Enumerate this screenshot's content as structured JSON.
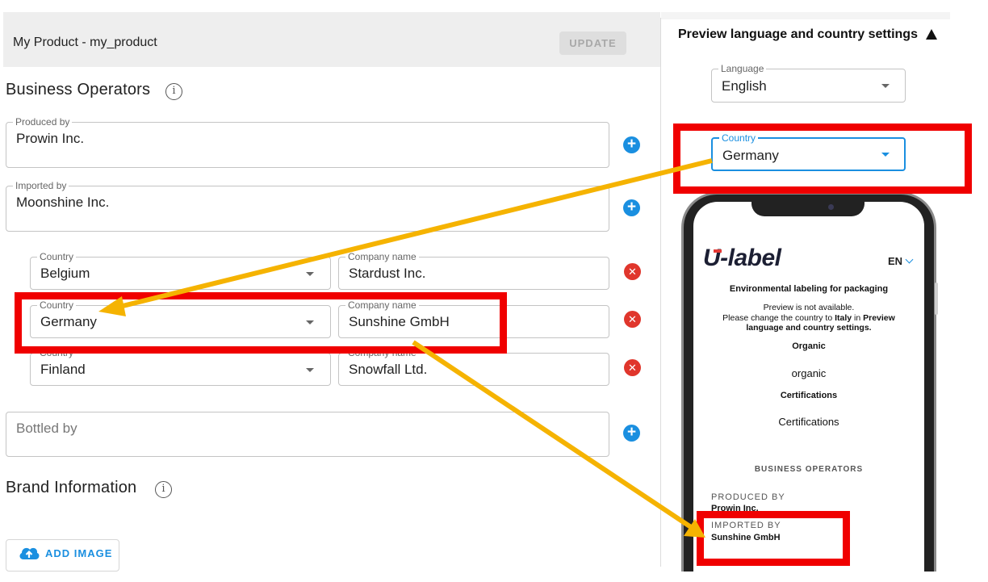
{
  "header": {
    "title": "My Product - my_product",
    "update_label": "UPDATE"
  },
  "business_operators": {
    "heading": "Business Operators",
    "produced_by": {
      "label": "Produced by",
      "value": "Prowin Inc."
    },
    "imported_by": {
      "label": "Imported by",
      "value": "Moonshine Inc."
    },
    "rows": [
      {
        "country_label": "Country",
        "country": "Belgium",
        "company_label": "Company name",
        "company": "Stardust Inc."
      },
      {
        "country_label": "Country",
        "country": "Germany",
        "company_label": "Company name",
        "company": "Sunshine GmbH"
      },
      {
        "country_label": "Country",
        "country": "Finland",
        "company_label": "Company name",
        "company": "Snowfall Ltd."
      }
    ],
    "bottled_by": {
      "placeholder": "Bottled by"
    }
  },
  "brand": {
    "heading": "Brand Information",
    "add_image_label": "ADD IMAGE"
  },
  "preview": {
    "title": "Preview language and country settings",
    "language": {
      "label": "Language",
      "value": "English"
    },
    "country": {
      "label": "Country",
      "value": "Germany"
    }
  },
  "phone": {
    "logo": "U-label",
    "lang_code": "EN",
    "subtitle": "Environmental labeling for packaging",
    "notice_line1": "Preview is not available.",
    "notice_line2_pre": "Please change the country to ",
    "notice_italy": "Italy",
    "notice_line2_mid": " in ",
    "notice_preview": "Preview",
    "notice_line3": "language and country settings.",
    "organic_heading": "Organic",
    "organic_value": "organic",
    "cert_heading": "Certifications",
    "cert_value": "Certifications",
    "bo_heading": "BUSINESS OPERATORS",
    "produced_by_label": "PRODUCED BY",
    "produced_by_value": "Prowin Inc.",
    "imported_by_label": "IMPORTED BY",
    "imported_by_value": "Sunshine GmbH"
  },
  "colors": {
    "accent": "#1a8fe0",
    "highlight": "#f00000",
    "arrow": "#f5b301",
    "remove": "#e0362c"
  }
}
